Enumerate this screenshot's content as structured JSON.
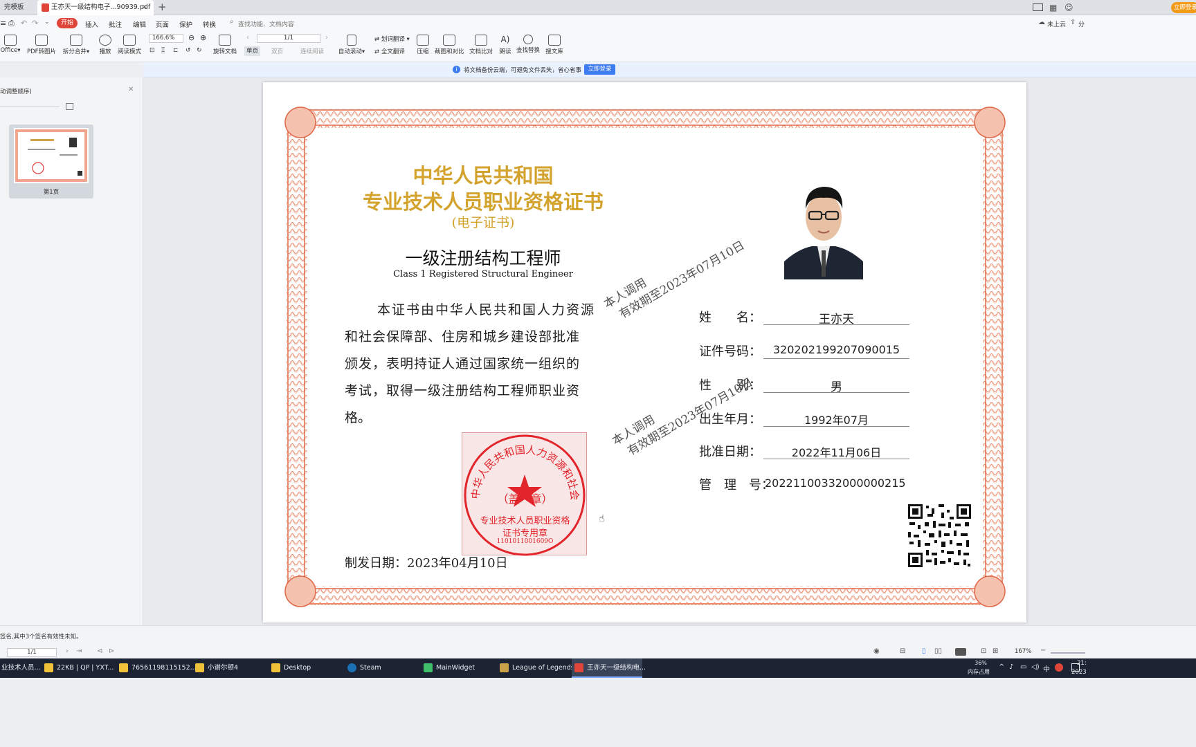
{
  "tabs": [
    {
      "label": "完模板"
    },
    {
      "label": "王亦天一级结构电子...90939.pdf"
    }
  ],
  "window": {
    "login_button": "立即登录"
  },
  "menu": {
    "items": [
      "开始",
      "插入",
      "批注",
      "编辑",
      "页面",
      "保护",
      "转换"
    ],
    "search_placeholder": "查找功能、文档内容",
    "cloud_status": "未上云",
    "share": "分"
  },
  "toolbar": {
    "office": "Office",
    "pdf_to_image": "PDF转图片",
    "split_merge": "拆分合并",
    "play": "播放",
    "read_mode": "阅读模式",
    "zoom": "166.6%",
    "rotate": "旋转文档",
    "page_input": "1/1",
    "single_page": "单页",
    "double_page": "双页",
    "continuous": "连续阅读",
    "auto_scroll": "自动滚动",
    "word_translate": "划词翻译",
    "full_translate": "全文翻译",
    "compress": "压缩",
    "screenshot_compare": "截图和对比",
    "doc_compare": "文档比对",
    "read_aloud": "朗读",
    "find_replace": "查找替换",
    "search_lib": "搜文库"
  },
  "notice": {
    "text": "将文档备份云端，可避免文件丢失，省心省事",
    "button": "立即登录"
  },
  "sidebar": {
    "title": "动调整顺序)",
    "thumb_label": "第1页"
  },
  "certificate": {
    "title1": "中华人民共和国",
    "title2": "专业技术人员职业资格证书",
    "title3": "(电子证书)",
    "cert_name": "一级注册结构工程师",
    "cert_name_en": "Class 1 Registered Structural Engineer",
    "body_lines": [
      "本证书由中华人民共和国人力资源",
      "和社会保障部、住房和城乡建设部批准",
      "颁发，表明持证人通过国家统一组织的",
      "考试，取得一级注册结构工程师职业资",
      "格。"
    ],
    "fields": [
      {
        "label": "姓　　名：",
        "value": "王亦天"
      },
      {
        "label": "证件号码：",
        "value": "320202199207090015"
      },
      {
        "label": "性　　别：",
        "value": "男"
      },
      {
        "label": "出生年月：",
        "value": "1992年07月"
      },
      {
        "label": "批准日期：",
        "value": "2022年11月06日"
      },
      {
        "label": "管　理　号：",
        "value": "20221100332000000215"
      }
    ],
    "issue_date": "制发日期：2023年04月10日",
    "watermark1": {
      "line1": "本人调用",
      "line2": "有效期至2023年07月10日"
    },
    "watermark2": {
      "line1": "本人调用",
      "line2": "有效期至2023年07月10日"
    },
    "seal": {
      "ring_text": "中华人民共和国人力资源和社会保障部",
      "center": "（盖　章）",
      "line1": "专业技术人员职业资格",
      "line2": "证书专用章",
      "code": "1101011001609O"
    }
  },
  "status": {
    "signature_note": "签名,其中3个签名有效性未知。",
    "page": "1/1",
    "zoom": "167%"
  },
  "taskbar": {
    "items": [
      {
        "label": "业技术人员...",
        "color": "#d84a3a"
      },
      {
        "label": "22KB | QP | YXT...",
        "color": "#f0c23a"
      },
      {
        "label": "76561198115152...",
        "color": "#f0c23a"
      },
      {
        "label": "小谢尔顿4",
        "color": "#f0c23a"
      },
      {
        "label": "Desktop",
        "color": "#f0c23a"
      },
      {
        "label": "Steam",
        "color": "#1b6fb3"
      },
      {
        "label": "MainWidget",
        "color": "#3fbf6a"
      },
      {
        "label": "League of Legends",
        "color": "#c9a24a"
      },
      {
        "label": "王亦天一级结构电...",
        "color": "#e0453a"
      }
    ],
    "mem_percent": "36%",
    "mem_label": "内存占用",
    "ime": "中",
    "time": "21:",
    "date": "2023"
  }
}
